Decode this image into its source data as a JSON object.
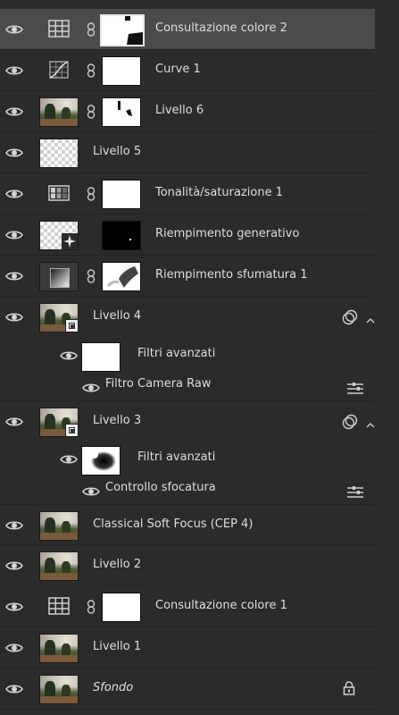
{
  "layers": [
    {
      "name": "Consultazione colore 2",
      "kind": "grid-adjustment"
    },
    {
      "name": "Curve 1",
      "kind": "curves-adjustment"
    },
    {
      "name": "Livello 6",
      "kind": "photo-mask"
    },
    {
      "name": "Livello 5",
      "kind": "transparent"
    },
    {
      "name": "Tonalità/saturazione 1",
      "kind": "hue-adjustment"
    },
    {
      "name": "Riempimento generativo",
      "kind": "generative"
    },
    {
      "name": "Riempimento sfumatura 1",
      "kind": "gradient-fill"
    },
    {
      "name": "Livello 4",
      "kind": "smart-object"
    },
    {
      "name": "Filtri avanzati",
      "kind": "smart-filters"
    },
    {
      "name": "Filtro Camera Raw",
      "kind": "filter"
    },
    {
      "name": "Livello 3",
      "kind": "smart-object"
    },
    {
      "name": "Filtri avanzati",
      "kind": "smart-filters"
    },
    {
      "name": "Controllo sfocatura",
      "kind": "filter"
    },
    {
      "name": "Classical Soft Focus (CEP 4)",
      "kind": "photo"
    },
    {
      "name": "Livello 2",
      "kind": "photo"
    },
    {
      "name": "Consultazione colore 1",
      "kind": "grid-adjustment"
    },
    {
      "name": "Livello 1",
      "kind": "photo"
    },
    {
      "name": "Sfondo",
      "kind": "background"
    }
  ],
  "colors": {
    "panel": "#2b2b2b",
    "selected": "#4b4b4b",
    "text": "#dedede",
    "icon": "#cfcfcf"
  }
}
